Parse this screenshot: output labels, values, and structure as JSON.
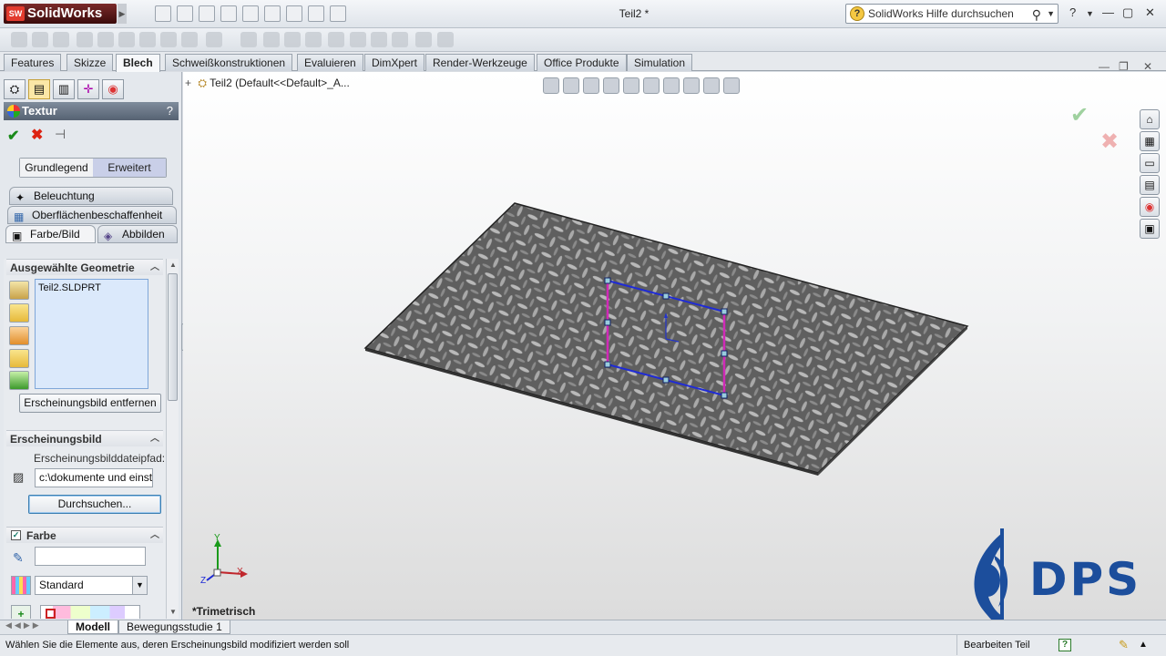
{
  "app": {
    "logo_text": "SolidWorks",
    "title": "Teil2 *",
    "search_placeholder": "SolidWorks Hilfe durchsuchen"
  },
  "tabs": [
    "Features",
    "Skizze",
    "Blech",
    "Schweißkonstruktionen",
    "Evaluieren",
    "DimXpert",
    "Render-Werkzeuge",
    "Office Produkte",
    "Simulation"
  ],
  "active_tab": "Blech",
  "property_manager": {
    "title": "Textur",
    "help": "?",
    "mode_basic": "Grundlegend",
    "mode_advanced": "Erweitert",
    "subtabs": {
      "lighting": "Beleuchtung",
      "surface": "Oberflächenbeschaffenheit",
      "color_image": "Farbe/Bild",
      "mapping": "Abbilden"
    },
    "selected_geometry": {
      "header": "Ausgewählte Geometrie",
      "items": [
        "Teil2.SLDPRT"
      ],
      "remove_button": "Erscheinungsbild entfernen"
    },
    "appearance": {
      "header": "Erscheinungsbild",
      "path_label": "Erscheinungsbilddateipfad:",
      "path_value": "c:\\dokumente und einste",
      "browse_button": "Durchsuchen..."
    },
    "color": {
      "header": "Farbe",
      "checked": true,
      "hex_value": "",
      "dropdown_value": "Standard"
    }
  },
  "graphics": {
    "tree_text": "Teil2  (Default<<Default>_A...",
    "view_orientation": "*Trimetrisch",
    "brand": "DPS",
    "axes": {
      "x": "X",
      "y": "Y",
      "z": "Z"
    }
  },
  "bottom_tabs": [
    "Modell",
    "Bewegungsstudie 1"
  ],
  "status": {
    "message": "Wählen Sie die Elemente aus, deren Erscheinungsbild modifiziert werden soll",
    "mode": "Bearbeiten Teil"
  },
  "colors": {
    "sketch_blue": "#1f2bd6",
    "sketch_magenta": "#d02ab8",
    "brand_blue": "#1c4e9c"
  }
}
